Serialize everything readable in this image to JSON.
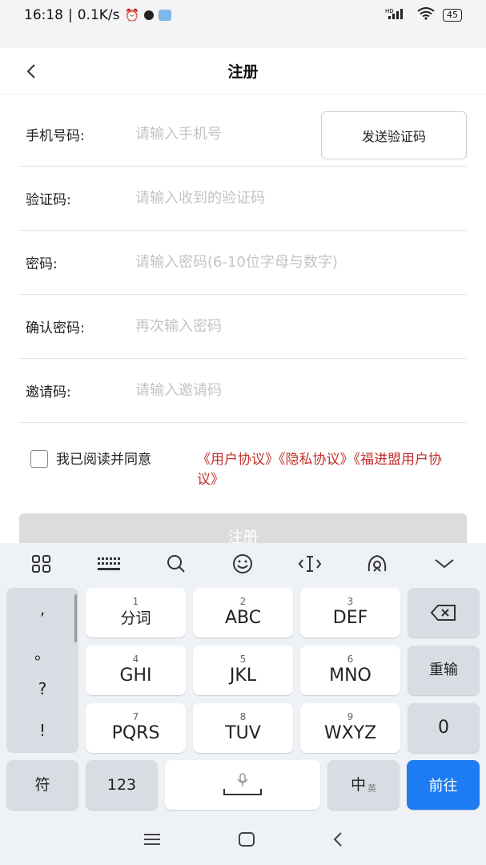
{
  "status": {
    "time": "16:18",
    "speed": "0.1K/s",
    "battery": "45",
    "network": "HD"
  },
  "nav": {
    "title": "注册"
  },
  "form": {
    "phone_label": "手机号码:",
    "phone_placeholder": "请输入手机号",
    "send_code": "发送验证码",
    "code_label": "验证码:",
    "code_placeholder": "请输入收到的验证码",
    "password_label": "密码:",
    "password_placeholder": "请输入密码(6-10位字母与数字)",
    "confirm_label": "确认密码:",
    "confirm_placeholder": "再次输入密码",
    "invite_label": "邀请码:",
    "invite_placeholder": "请输入邀请码"
  },
  "agreement": {
    "text": "我已阅读并同意",
    "links": "《用户协议》《隐私协议》《福进盟用户协议》"
  },
  "register_button": "注册",
  "keyboard": {
    "punct": [
      ",",
      "。",
      "?",
      "!"
    ],
    "keys": [
      {
        "num": "1",
        "label": "分词"
      },
      {
        "num": "2",
        "label": "ABC"
      },
      {
        "num": "3",
        "label": "DEF"
      },
      {
        "num": "4",
        "label": "GHI"
      },
      {
        "num": "5",
        "label": "JKL"
      },
      {
        "num": "6",
        "label": "MNO"
      },
      {
        "num": "7",
        "label": "PQRS"
      },
      {
        "num": "8",
        "label": "TUV"
      },
      {
        "num": "9",
        "label": "WXYZ"
      }
    ],
    "retype": "重输",
    "zero": "0",
    "symbol": "符",
    "num123": "123",
    "lang_main": "中",
    "lang_sub": "英",
    "go": "前往"
  },
  "colors": {
    "accent": "#1e7cf2",
    "link": "#c0302b",
    "disabled_button": "#dcdcdc"
  }
}
